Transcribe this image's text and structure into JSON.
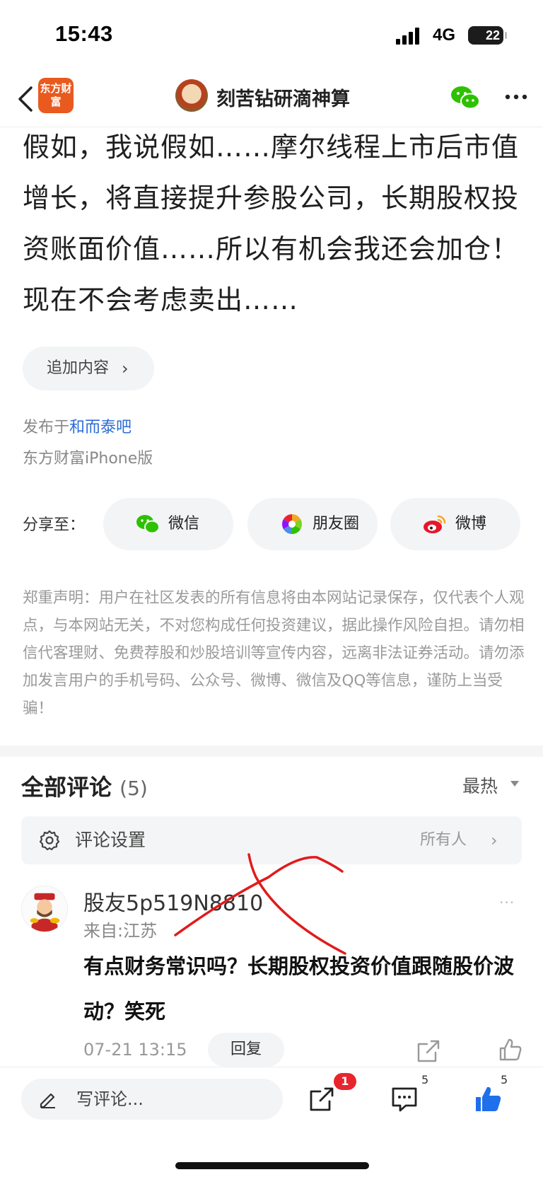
{
  "status_bar": {
    "time": "15:43",
    "network": "4G",
    "battery": "22",
    "battery_level": 0.22
  },
  "nav": {
    "logo_text": "东方财富",
    "title": "刻苦钻研滴神算"
  },
  "post": {
    "body": "假如，我说假如……摩尔线程上市后市值增长，将直接提升参股公司，长期股权投资账面价值……所以有机会我还会加仓！现在不会考虑卖出……",
    "append_label": "追加内容",
    "published_prefix": "发布于",
    "forum": "和而泰吧",
    "client": "东方财富iPhone版"
  },
  "share": {
    "label": "分享至：",
    "targets": [
      {
        "label": "微信",
        "icon": "wechat-icon"
      },
      {
        "label": "朋友圈",
        "icon": "moments-icon"
      },
      {
        "label": "微博",
        "icon": "weibo-icon"
      }
    ]
  },
  "disclaimer": "郑重声明：用户在社区发表的所有信息将由本网站记录保存，仅代表个人观点，与本网站无关，不对您构成任何投资建议，据此操作风险自担。请勿相信代客理财、免费荐股和炒股培训等宣传内容，远离非法证券活动。请勿添加发言用户的手机号码、公众号、微博、微信及QQ等信息，谨防上当受骗！",
  "comments": {
    "title": "全部评论",
    "count": "(5)",
    "sort": "最热",
    "settings_label": "评论设置",
    "settings_value": "所有人",
    "items": [
      {
        "user": "股友5p519N8810",
        "location": "来自:江苏",
        "text": "有点财务常识吗？长期股权投资价值跟随股价波动？笑死",
        "time": "07-21 13:15",
        "reply_label": "回复",
        "more": "···"
      }
    ]
  },
  "bottom_bar": {
    "compose_placeholder": "写评论...",
    "share_badge": "1",
    "comment_count": "5",
    "like_count": "5"
  },
  "colors": {
    "brand": "#e95a1e",
    "link": "#2c6cd6",
    "like": "#1f6feb",
    "badge": "#e8252d",
    "annotation": "#e01b1b"
  }
}
